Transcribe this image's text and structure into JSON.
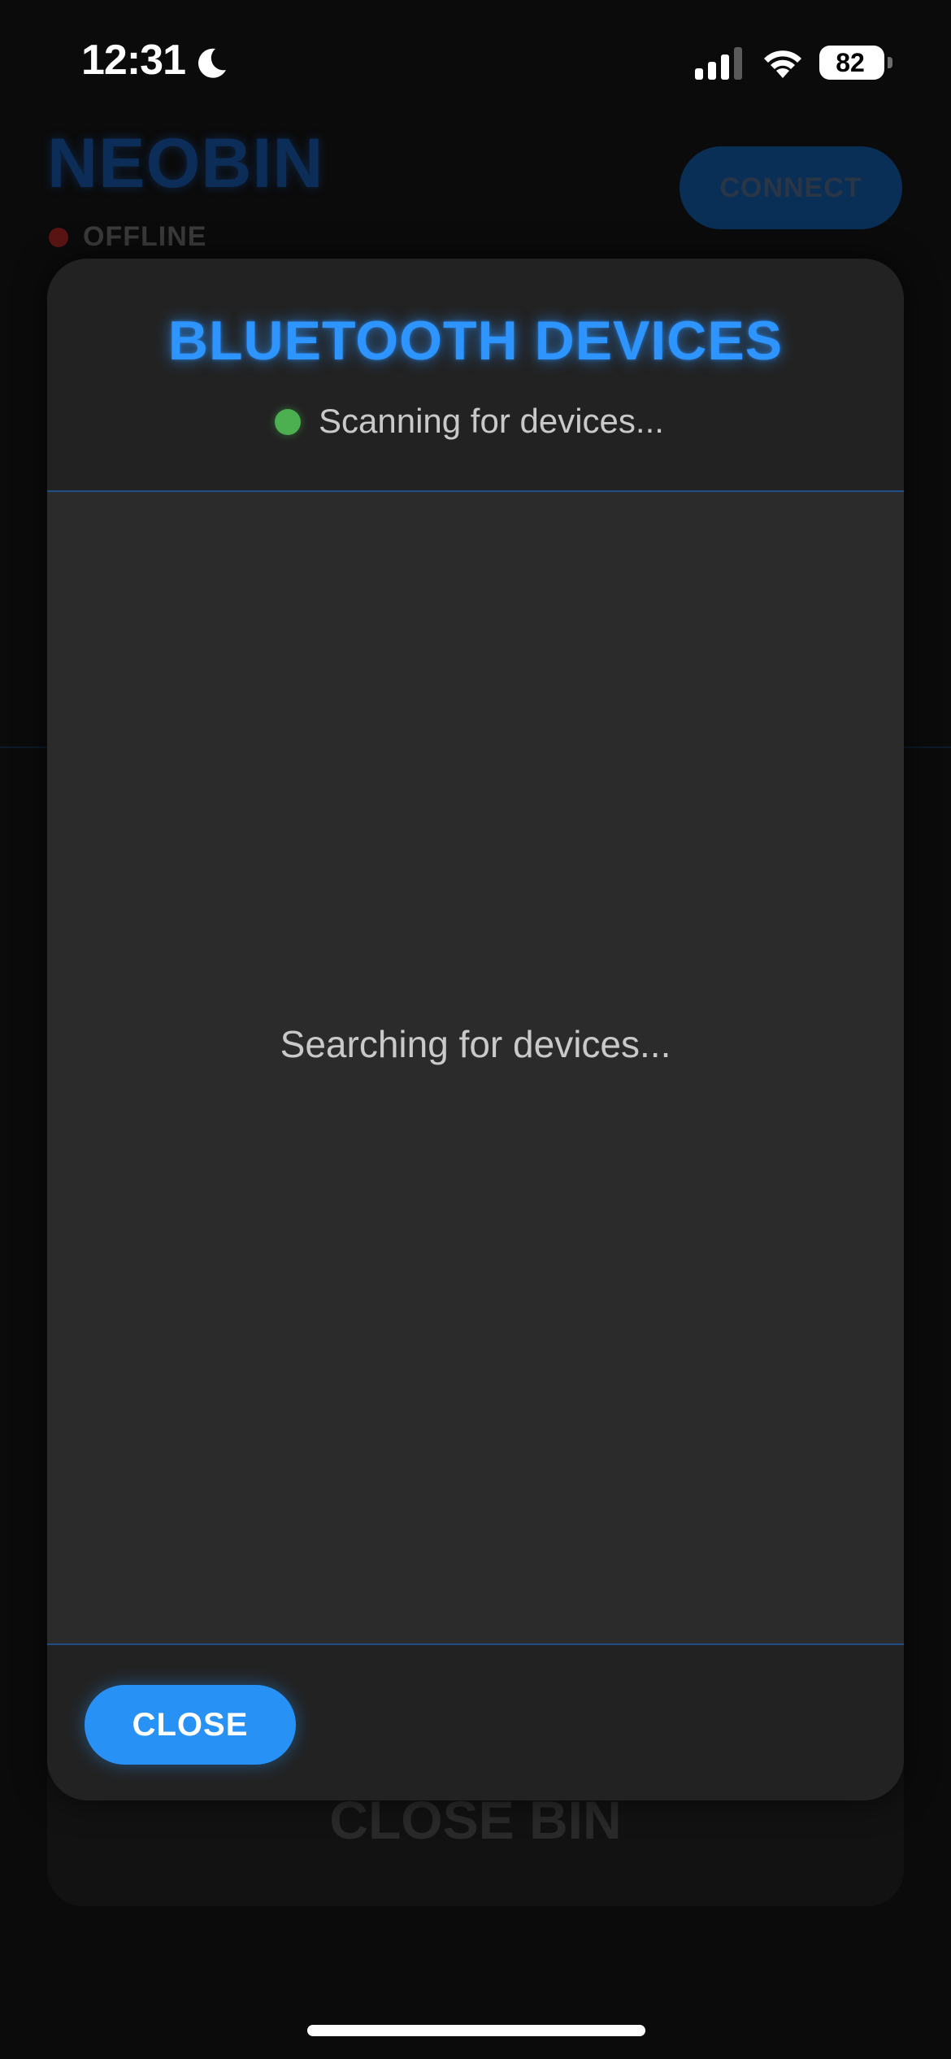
{
  "status_bar": {
    "time": "12:31",
    "battery": "82",
    "icons": [
      "moon-icon",
      "signal-icon",
      "wifi-icon",
      "battery-icon"
    ]
  },
  "app": {
    "brand": "NEOBIN",
    "connection_status": "OFFLINE",
    "connect_label": "CONNECT",
    "close_bin_label": "CLOSE BIN"
  },
  "modal": {
    "title": "BLUETOOTH DEVICES",
    "scan_status": "Scanning for devices...",
    "empty_message": "Searching for devices...",
    "close_label": "CLOSE"
  },
  "colors": {
    "accent": "#2e94ff",
    "scan_indicator": "#4caf50",
    "offline": "#5a1414",
    "modal_bg": "#222222",
    "list_bg": "#2b2b2b"
  }
}
